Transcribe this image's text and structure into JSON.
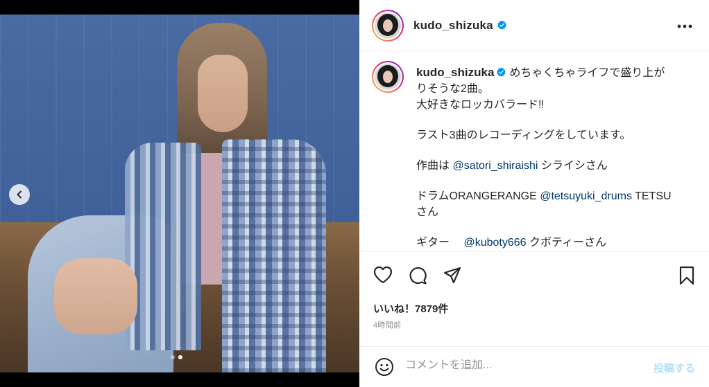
{
  "post": {
    "username": "kudo_shizuka",
    "verified": true,
    "caption_paragraphs": [
      [
        "めちゃくちゃライフで盛り上が",
        "りそうな2曲。",
        "大好きなロッカバラード‼︎"
      ],
      [
        "ラスト3曲のレコーディングをしています。"
      ],
      [
        "作曲は ",
        "@satori_shiraishi",
        " シライシさん"
      ],
      [
        "ドラムORANGERANGE ",
        "@tetsuyuki_drums",
        " TETSU",
        "さん"
      ],
      [
        "ギター　 ",
        "@kuboty666",
        " クボティーさん"
      ]
    ],
    "likes": "いいね！7879件",
    "time_ago": "4時間前"
  },
  "media": {
    "slide_count": 2,
    "active_slide": 2
  },
  "comment": {
    "placeholder": "コメントを追加...",
    "post_label": "投稿する"
  },
  "icons": {
    "more": "more-horizontal-icon",
    "like": "heart-icon",
    "comment": "comment-icon",
    "share": "share-icon",
    "save": "bookmark-icon",
    "emoji": "emoji-icon",
    "prev": "chevron-left-icon",
    "verified": "verified-badge-icon"
  },
  "colors": {
    "verified": "#0095f6",
    "mention": "#00376b",
    "post_button_disabled": "#b2dffc",
    "secondary_text": "#8e8e8e"
  }
}
